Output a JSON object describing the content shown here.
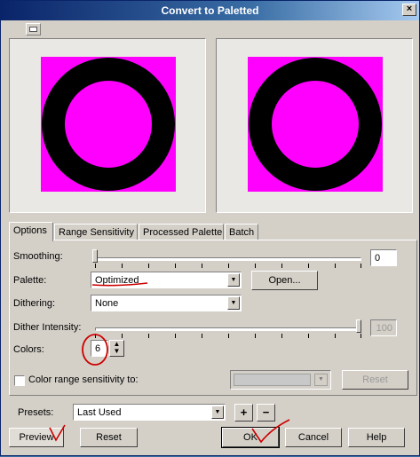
{
  "window": {
    "title": "Convert to Paletted",
    "close_label": "×"
  },
  "tabs": [
    "Options",
    "Range Sensitivity",
    "Processed Palette",
    "Batch"
  ],
  "options": {
    "smoothing_label": "Smoothing:",
    "smoothing_value": "0",
    "palette_label": "Palette:",
    "palette_value": "Optimized",
    "open_button": "Open...",
    "dithering_label": "Dithering:",
    "dithering_value": "None",
    "dither_intensity_label": "Dither Intensity:",
    "dither_intensity_value": "100",
    "colors_label": "Colors:",
    "colors_value": "6",
    "color_range_label": "Color range sensitivity to:",
    "color_range_reset": "Reset"
  },
  "presets": {
    "label": "Presets:",
    "value": "Last Used",
    "add": "+",
    "remove": "−"
  },
  "buttons": {
    "preview": "Preview",
    "reset": "Reset",
    "ok": "OK",
    "cancel": "Cancel",
    "help": "Help"
  },
  "colors": {
    "preview_bg": "#ff00ff",
    "ring": "#000000",
    "annotation": "#cc0000"
  },
  "icons": {
    "compare": "before-after-toggle-icon",
    "close": "close-icon"
  }
}
